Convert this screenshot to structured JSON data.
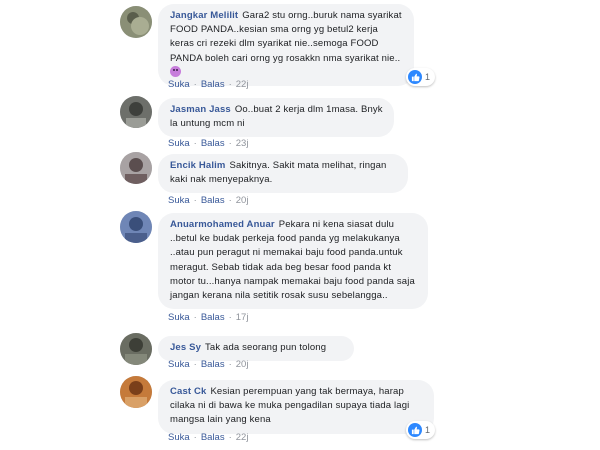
{
  "comments": [
    {
      "author": "Jangkar Melilit",
      "text": "Gara2 stu orng..buruk nama syarikat FOOD PANDA..kesian sma orng yg betul2 kerja keras cri rezeki dlm syarikat nie..semoga FOOD PANDA boleh cari orng yg rosakkn nma syarikat nie..",
      "emoji": "purple-devil-emoji",
      "like_label": "Suka",
      "reply_label": "Balas",
      "time": "22j",
      "reactions": "1"
    },
    {
      "author": "Jasman Jass",
      "text": "Oo..buat 2 kerja dlm 1masa. Bnyk la untung mcm ni",
      "like_label": "Suka",
      "reply_label": "Balas",
      "time": "23j"
    },
    {
      "author": "Encik Halim",
      "text": "Sakitnya. Sakit mata melihat, ringan kaki nak menyepaknya.",
      "like_label": "Suka",
      "reply_label": "Balas",
      "time": "20j"
    },
    {
      "author": "Anuarmohamed Anuar",
      "text": "Pekara ni kena siasat dulu ..betul ke budak perkeja food panda yg melakukanya ..atau pun peragut ni memakai baju food panda.untuk meragut. Sebab tidak ada beg besar food panda kt motor tu...hanya nampak memakai baju food panda saja jangan kerana nila setitik rosak susu sebelangga..",
      "like_label": "Suka",
      "reply_label": "Balas",
      "time": "17j"
    },
    {
      "author": "Jes Sy",
      "text": "Tak ada seorang pun tolong",
      "like_label": "Suka",
      "reply_label": "Balas",
      "time": "20j"
    },
    {
      "author": "Cast Ck",
      "text": "Kesian perempuan yang tak bermaya, harap cilaka ni di bawa ke muka pengadilan supaya tiada lagi mangsa lain yang kena",
      "like_label": "Suka",
      "reply_label": "Balas",
      "time": "22j",
      "reactions": "1"
    }
  ],
  "separator": "·",
  "colors": {
    "author": "#385898",
    "bubble": "#f2f3f5",
    "like_blue": "#2d88ff",
    "meta": "#90949c"
  }
}
